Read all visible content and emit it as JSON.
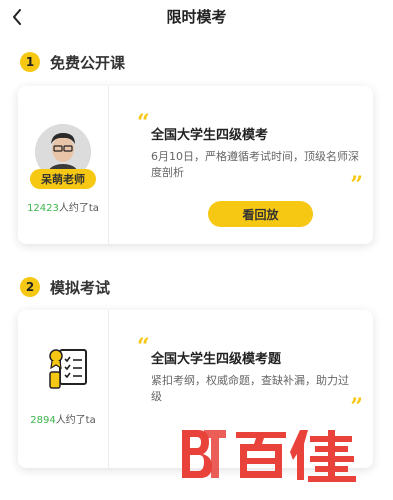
{
  "header": {
    "title": "限时模考"
  },
  "section1": {
    "number": "1",
    "title": "免费公开课",
    "card": {
      "teacher_name": "呆萌老师",
      "appoint_count": "12423",
      "appoint_suffix": "人约了ta",
      "open_quote": "“",
      "close_quote": "”",
      "course_title": "全国大学生四级模考",
      "course_desc": "6月10日，严格遵循考试时间，顶级名师深度剖析",
      "button_label": "看回放"
    }
  },
  "section2": {
    "number": "2",
    "title": "模拟考试",
    "card": {
      "appoint_count": "2894",
      "appoint_suffix": "人约了ta",
      "open_quote": "“",
      "close_quote": "”",
      "course_title": "全国大学生四级模考题",
      "course_desc": "紧扣考纲，权威命题，查缺补漏，助力过级"
    }
  },
  "watermark": {
    "text": "百佳"
  },
  "colors": {
    "accent": "#f6c813",
    "count_green": "#3db54a",
    "watermark_red": "#e8423a"
  },
  "icons": [
    "back-arrow-icon",
    "certificate-checklist-icon",
    "teacher-avatar"
  ]
}
